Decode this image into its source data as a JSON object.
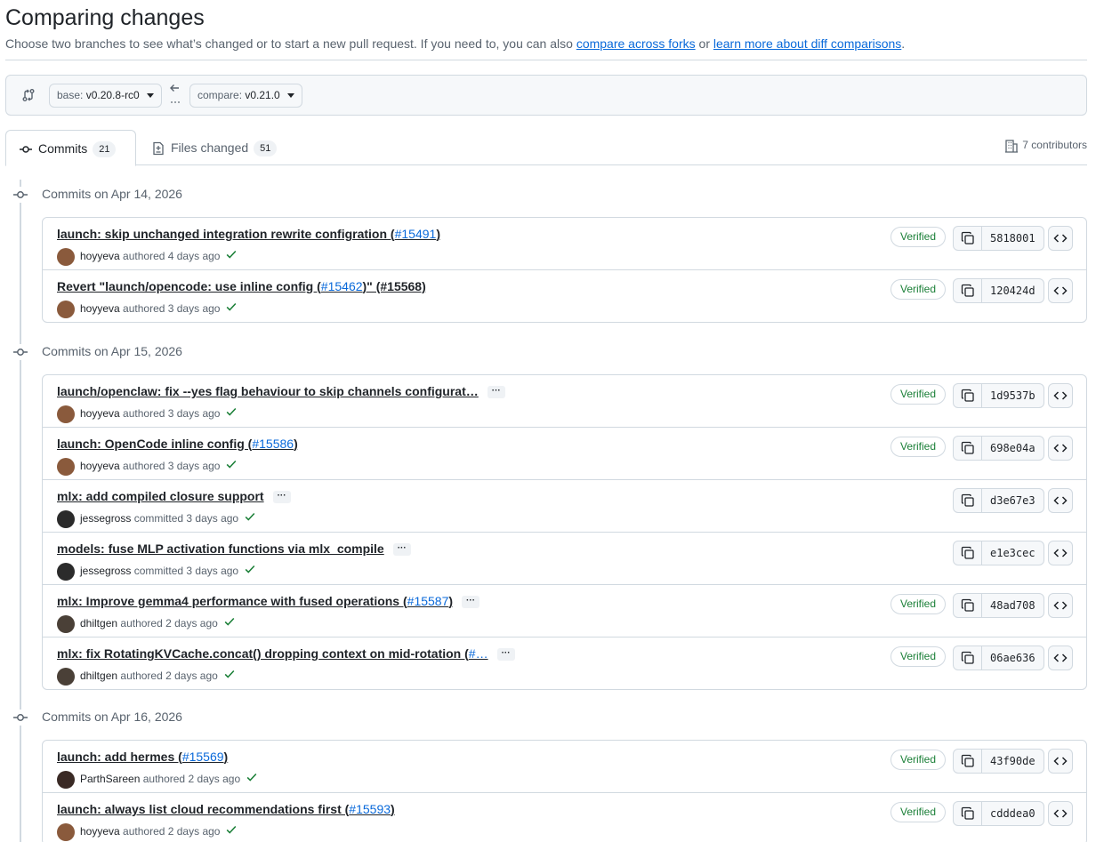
{
  "page": {
    "title": "Comparing changes",
    "subtitle_text": "Choose two branches to see what’s changed or to start a new pull request. If you need to, you can also ",
    "link_forks": "compare across forks",
    "or_text": " or ",
    "link_learn": "learn more about diff comparisons",
    "period": "."
  },
  "range": {
    "base_prefix": "base: ",
    "base_value": "v0.20.8-rc0",
    "compare_prefix": "compare: ",
    "compare_value": "v0.21.0"
  },
  "tabs": {
    "commits_label": "Commits",
    "commits_count": "21",
    "files_label": "Files changed",
    "files_count": "51",
    "contributors": "7 contributors"
  },
  "colors": {
    "accent": "#0969da",
    "verified": "#1a7f37",
    "border": "#d1d9e0",
    "muted": "#59636e"
  },
  "groups": [
    {
      "heading": "Commits on Apr 14, 2026",
      "commits": [
        {
          "message": "launch: skip unchanged integration rewrite configration (",
          "pr": "#15491",
          "tail": ")",
          "ellipsis": false,
          "author": "hoyyeva",
          "action": "authored 4 days ago",
          "verified": "Verified",
          "sha": "5818001",
          "avatar": "#8a5a3c"
        },
        {
          "message": "Revert \"launch/opencode: use inline config (",
          "pr": "#15462",
          "tail": ")\" (#15568)",
          "ellipsis": false,
          "author": "hoyyeva",
          "action": "authored 3 days ago",
          "verified": "Verified",
          "sha": "120424d",
          "avatar": "#8a5a3c"
        }
      ]
    },
    {
      "heading": "Commits on Apr 15, 2026",
      "commits": [
        {
          "message": "launch/openclaw: fix --yes flag behaviour to skip channels configurat…",
          "pr": "",
          "tail": "",
          "ellipsis": true,
          "author": "hoyyeva",
          "action": "authored 3 days ago",
          "verified": "Verified",
          "sha": "1d9537b",
          "avatar": "#8a5a3c"
        },
        {
          "message": "launch: OpenCode inline config (",
          "pr": "#15586",
          "tail": ")",
          "ellipsis": false,
          "author": "hoyyeva",
          "action": "authored 3 days ago",
          "verified": "Verified",
          "sha": "698e04a",
          "avatar": "#8a5a3c"
        },
        {
          "message": "mlx: add compiled closure support",
          "pr": "",
          "tail": "",
          "ellipsis": true,
          "author": "jessegross",
          "action": "committed 3 days ago",
          "verified": "",
          "sha": "d3e67e3",
          "avatar": "#2b2b2b"
        },
        {
          "message": "models: fuse MLP activation functions via mlx_compile",
          "pr": "",
          "tail": "",
          "ellipsis": true,
          "author": "jessegross",
          "action": "committed 3 days ago",
          "verified": "",
          "sha": "e1e3cec",
          "avatar": "#2b2b2b"
        },
        {
          "message": "mlx: Improve gemma4 performance with fused operations (",
          "pr": "#15587",
          "tail": ")",
          "ellipsis": true,
          "author": "dhiltgen",
          "action": "authored 2 days ago",
          "verified": "Verified",
          "sha": "48ad708",
          "avatar": "#4a4037"
        },
        {
          "message": "mlx: fix RotatingKVCache.concat() dropping context on mid-rotation (",
          "pr": "#…",
          "tail": "",
          "ellipsis": true,
          "author": "dhiltgen",
          "action": "authored 2 days ago",
          "verified": "Verified",
          "sha": "06ae636",
          "avatar": "#4a4037"
        }
      ]
    },
    {
      "heading": "Commits on Apr 16, 2026",
      "commits": [
        {
          "message": "launch: add hermes (",
          "pr": "#15569",
          "tail": ")",
          "ellipsis": false,
          "author": "ParthSareen",
          "action": "authored 2 days ago",
          "verified": "Verified",
          "sha": "43f90de",
          "avatar": "#3a2a25"
        },
        {
          "message": "launch: always list cloud recommendations first (",
          "pr": "#15593",
          "tail": ")",
          "ellipsis": false,
          "author": "hoyyeva",
          "action": "authored 2 days ago",
          "verified": "Verified",
          "sha": "cdddea0",
          "avatar": "#8a5a3c"
        }
      ]
    }
  ]
}
